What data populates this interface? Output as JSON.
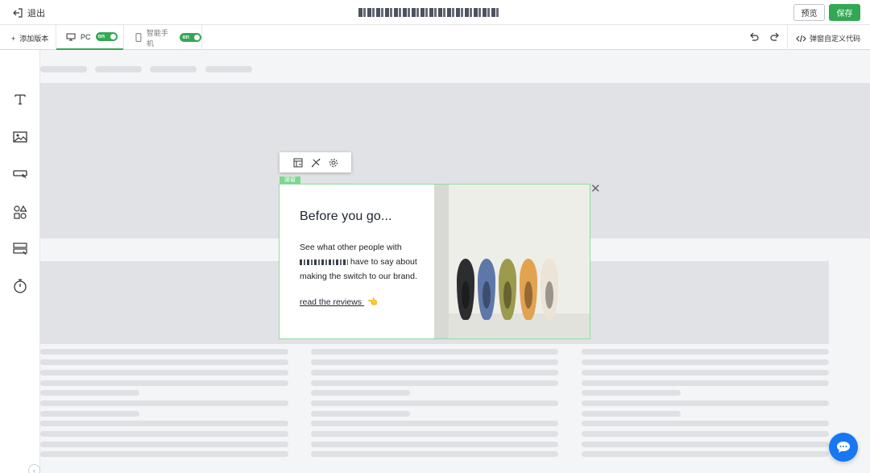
{
  "topbar": {
    "exit_label": "退出",
    "preview_label": "预览",
    "save_label": "保存"
  },
  "subbar": {
    "add_version_label": "添加版本",
    "pc_label": "PC",
    "pc_toggle": "on",
    "mobile_label": "智能手机",
    "mobile_toggle": "on",
    "custom_code_label": "弹窗自定义代码"
  },
  "tools": [
    {
      "icon": "text-icon"
    },
    {
      "icon": "image-icon"
    },
    {
      "icon": "button-icon"
    },
    {
      "icon": "shapes-icon"
    },
    {
      "icon": "form-icon"
    },
    {
      "icon": "timer-icon"
    }
  ],
  "popup": {
    "tag_label": "弹窗",
    "heading": "Before you go...",
    "body_line_1": "See what other people with",
    "body_line_2": "have to say about",
    "body_line_3": "making the switch to our brand.",
    "link_text": "read the reviews",
    "link_emoji": "👈"
  },
  "colors": {
    "accent_green": "#33a853",
    "chat_blue": "#1877f2"
  }
}
